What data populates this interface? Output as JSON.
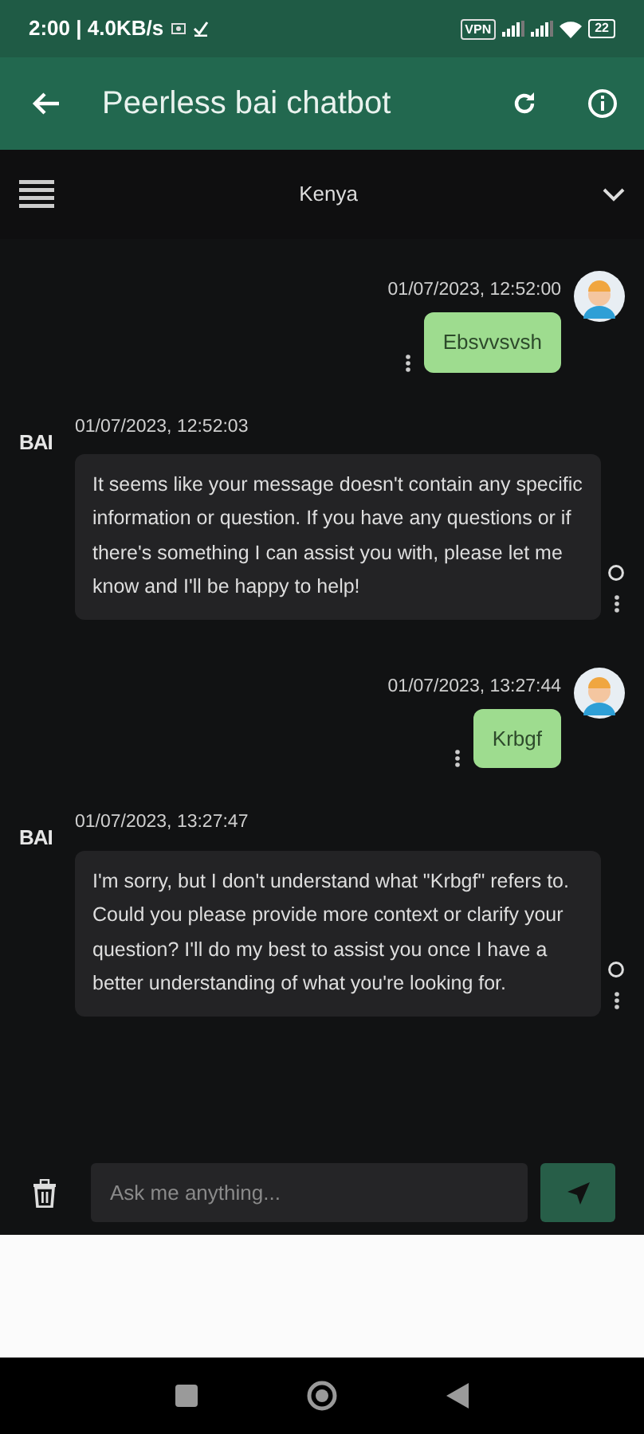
{
  "status_bar": {
    "time": "2:00 | 4.0KB/s",
    "vpn": "VPN",
    "battery": "22"
  },
  "app_bar": {
    "title": "Peerless bai chatbot"
  },
  "selector": {
    "value": "Kenya"
  },
  "messages": [
    {
      "kind": "user",
      "timestamp": "01/07/2023, 12:52:00",
      "text": "Ebsvvsvsh"
    },
    {
      "kind": "bot",
      "logo": "BAI",
      "timestamp": "01/07/2023, 12:52:03",
      "text": "It seems like your message doesn't contain any specific information or question. If you have any questions or if there's something I can assist you with, please let me know and I'll be happy to help!"
    },
    {
      "kind": "user",
      "timestamp": "01/07/2023, 13:27:44",
      "text": "Krbgf"
    },
    {
      "kind": "bot",
      "logo": "BAI",
      "timestamp": "01/07/2023, 13:27:47",
      "text": "I'm sorry, but I don't understand what \"Krbgf\" refers to. Could you please provide more context or clarify your question? I'll do my best to assist you once I have a better understanding of what you're looking for."
    }
  ],
  "composer": {
    "placeholder": "Ask me anything..."
  }
}
